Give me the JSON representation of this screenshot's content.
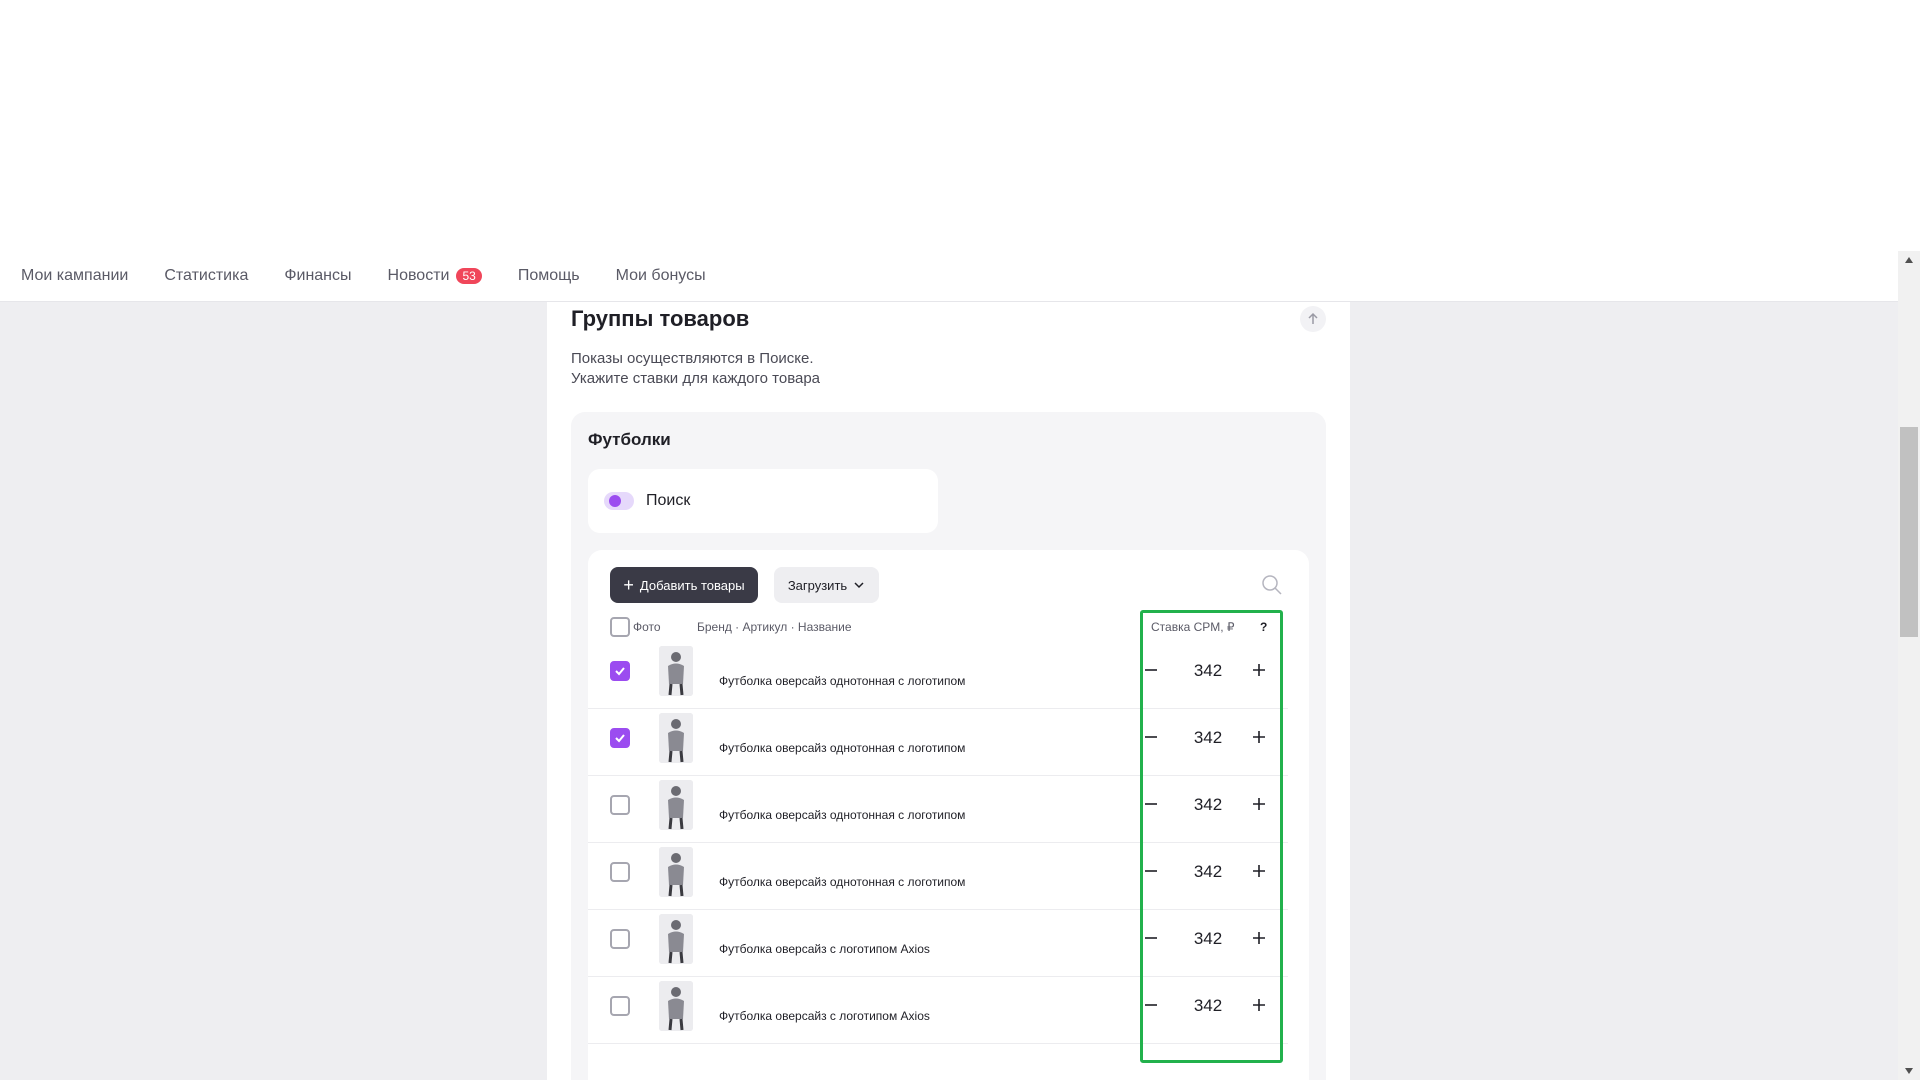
{
  "nav": {
    "items": [
      {
        "label": "Мои кампании"
      },
      {
        "label": "Статистика"
      },
      {
        "label": "Финансы"
      },
      {
        "label": "Новости",
        "badge": "53"
      },
      {
        "label": "Помощь"
      },
      {
        "label": "Мои бонусы"
      }
    ]
  },
  "section": {
    "title": "Группы товаров",
    "desc_line1": "Показы осуществляются в Поиске.",
    "desc_line2": "Укажите ставки для каждого товара"
  },
  "group": {
    "title": "Футболки",
    "placement_toggle_label": "Поиск",
    "placement_toggle_on": true
  },
  "toolbar": {
    "add_label": "Добавить товары",
    "load_label": "Загрузить"
  },
  "table": {
    "headers": {
      "photo": "Фото",
      "name": "Бренд · Артикул · Название",
      "cpm": "Ставка CPM, ₽",
      "help": "?"
    },
    "rows": [
      {
        "checked": true,
        "name": "Футболка оверсайз однотонная с логотипом",
        "cpm": "342"
      },
      {
        "checked": true,
        "name": "Футболка оверсайз однотонная с логотипом",
        "cpm": "342"
      },
      {
        "checked": false,
        "name": "Футболка оверсайз однотонная с логотипом",
        "cpm": "342"
      },
      {
        "checked": false,
        "name": "Футболка оверсайз однотонная с логотипом",
        "cpm": "342"
      },
      {
        "checked": false,
        "name": "Футболка оверсайз с логотипом Axios",
        "cpm": "342"
      },
      {
        "checked": false,
        "name": "Футболка оверсайз с логотипом Axios",
        "cpm": "342"
      }
    ]
  },
  "colors": {
    "accent": "#9b4cf0",
    "badge": "#f0465a",
    "highlight": "#22b14c"
  }
}
